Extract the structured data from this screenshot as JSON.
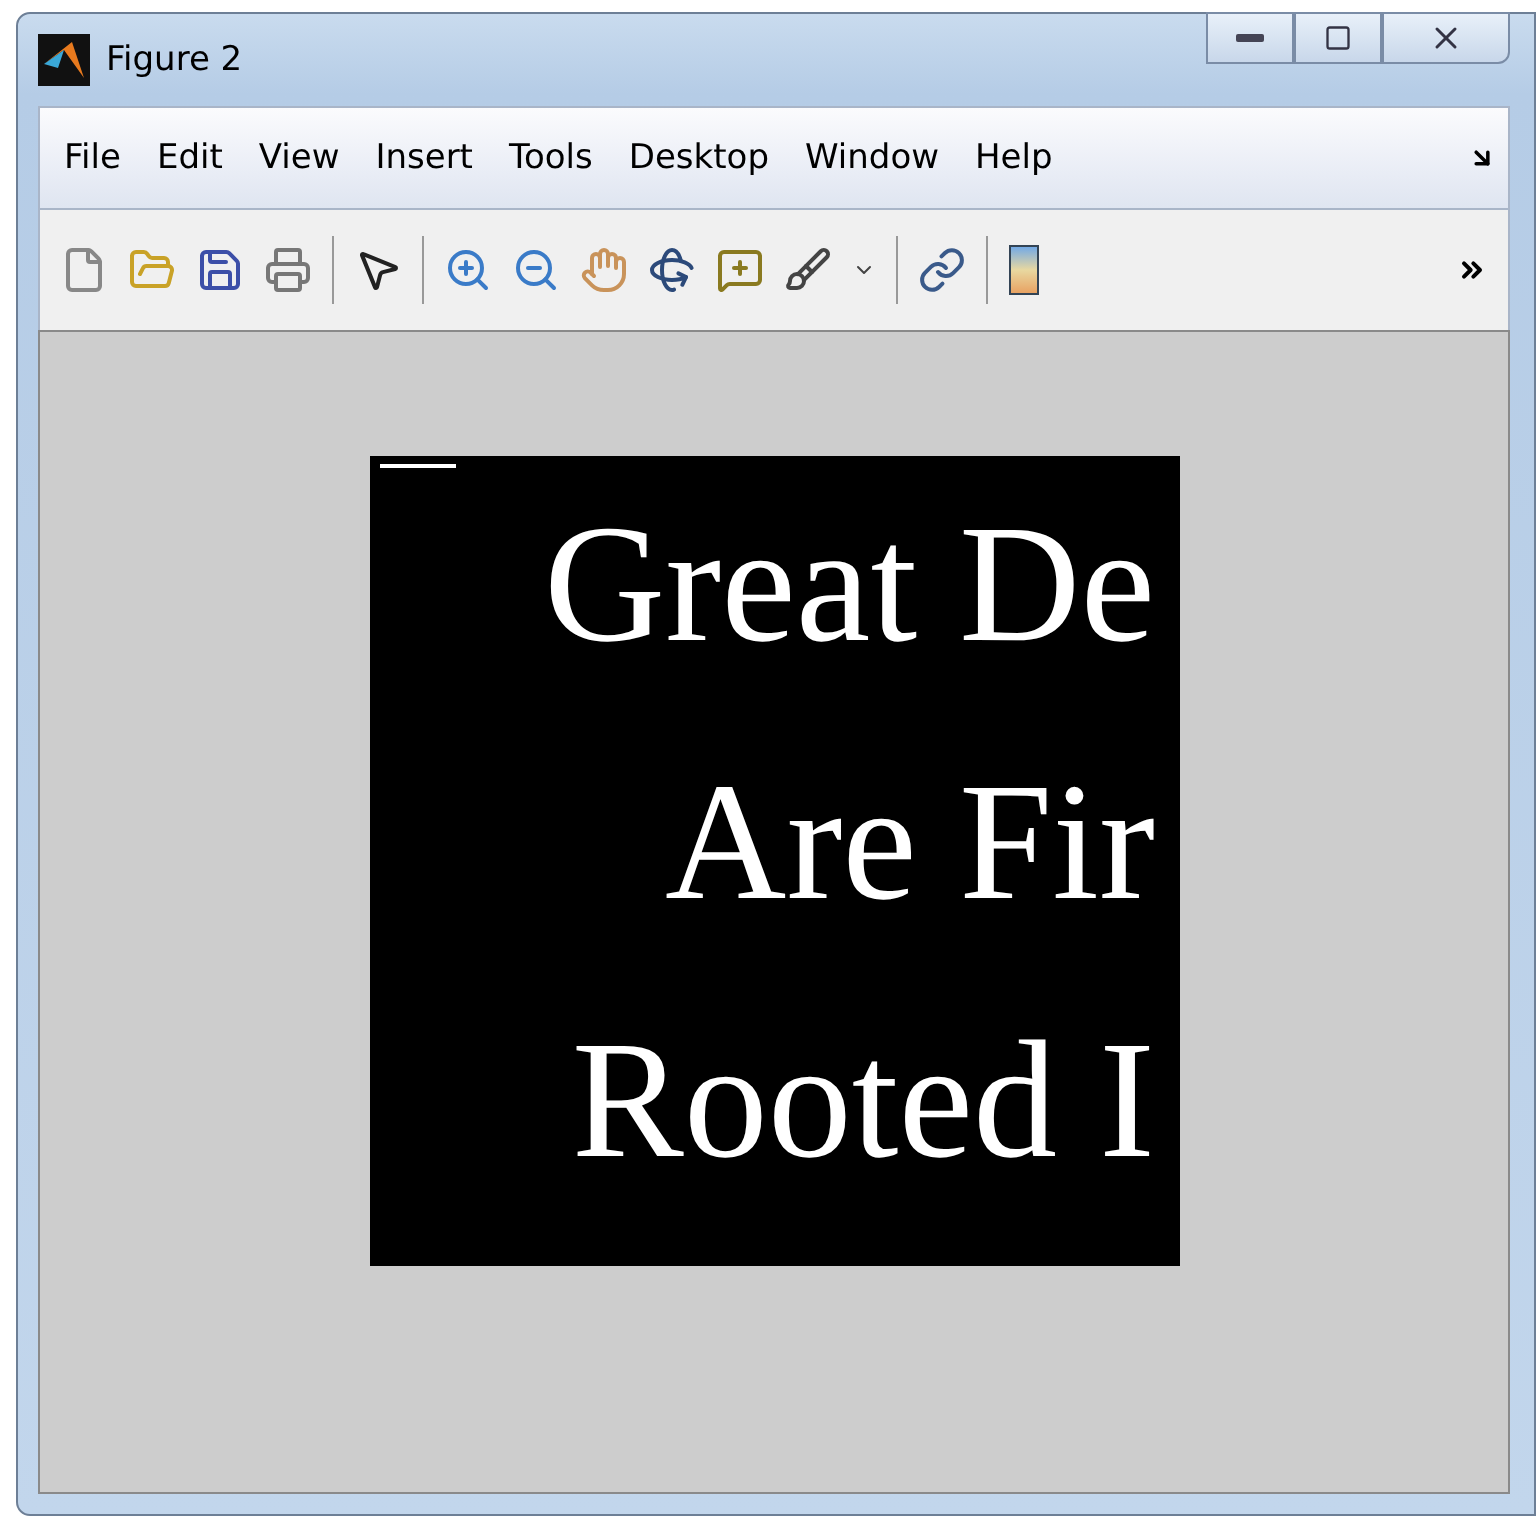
{
  "window": {
    "title": "Figure 2"
  },
  "menu_bar": {
    "items": [
      "File",
      "Edit",
      "View",
      "Insert",
      "Tools",
      "Desktop",
      "Window",
      "Help"
    ]
  },
  "figure_image": {
    "lines": [
      "Great De",
      "Are Fir",
      "Rooted I"
    ]
  }
}
